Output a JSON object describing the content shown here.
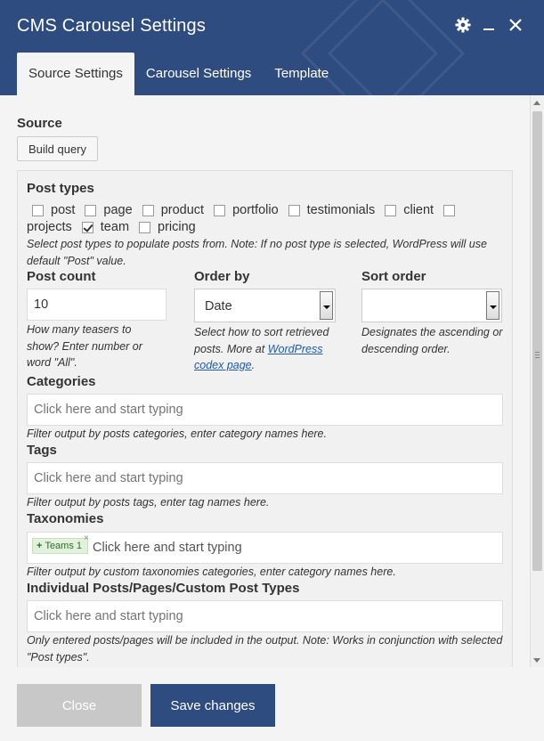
{
  "window": {
    "title": "CMS Carousel Settings",
    "icons": {
      "settings": "gear-icon",
      "minimize": "minimize-icon",
      "close": "close-icon"
    }
  },
  "tabs": [
    {
      "label": "Source Settings",
      "active": true
    },
    {
      "label": "Carousel Settings",
      "active": false
    },
    {
      "label": "Template",
      "active": false
    }
  ],
  "source": {
    "label": "Source",
    "build_query_label": "Build query"
  },
  "post_types": {
    "label": "Post types",
    "options": [
      {
        "label": "post",
        "checked": false
      },
      {
        "label": "page",
        "checked": false
      },
      {
        "label": "product",
        "checked": false
      },
      {
        "label": "portfolio",
        "checked": false
      },
      {
        "label": "testimonials",
        "checked": false
      },
      {
        "label": "client",
        "checked": false
      },
      {
        "label": "projects",
        "checked": false
      },
      {
        "label": "team",
        "checked": true
      },
      {
        "label": "pricing",
        "checked": false
      }
    ],
    "help": "Select post types to populate posts from. Note: If no post type is selected, WordPress will use default \"Post\" value."
  },
  "post_count": {
    "label": "Post count",
    "value": "10",
    "help": "How many teasers to show? Enter number or word \"All\"."
  },
  "order_by": {
    "label": "Order by",
    "value": "Date",
    "help_prefix": "Select how to sort retrieved posts. More at ",
    "help_link": "WordPress codex page",
    "help_suffix": "."
  },
  "sort_order": {
    "label": "Sort order",
    "value": "",
    "help": "Designates the ascending or descending order."
  },
  "categories": {
    "label": "Categories",
    "placeholder": "Click here and start typing",
    "help": "Filter output by posts categories, enter category names here."
  },
  "tags": {
    "label": "Tags",
    "placeholder": "Click here and start typing",
    "help": "Filter output by posts tags, enter tag names here."
  },
  "taxonomies": {
    "label": "Taxonomies",
    "chip": "Teams 1",
    "chip_plus": "+",
    "chip_remove": "×",
    "placeholder": "Click here and start typing",
    "help": "Filter output by custom taxonomies categories, enter category names here."
  },
  "individual": {
    "label": "Individual Posts/Pages/Custom Post Types",
    "placeholder": "Click here and start typing",
    "help": "Only entered posts/pages will be included in the output. Note: Works in conjunction with selected \"Post types\"."
  },
  "footer": {
    "close_label": "Close",
    "save_label": "Save changes"
  },
  "colors": {
    "header_bg": "#2e4c80",
    "save_button": "#2e4c80",
    "close_button": "#c8c8c8",
    "link": "#1e5ca8"
  }
}
